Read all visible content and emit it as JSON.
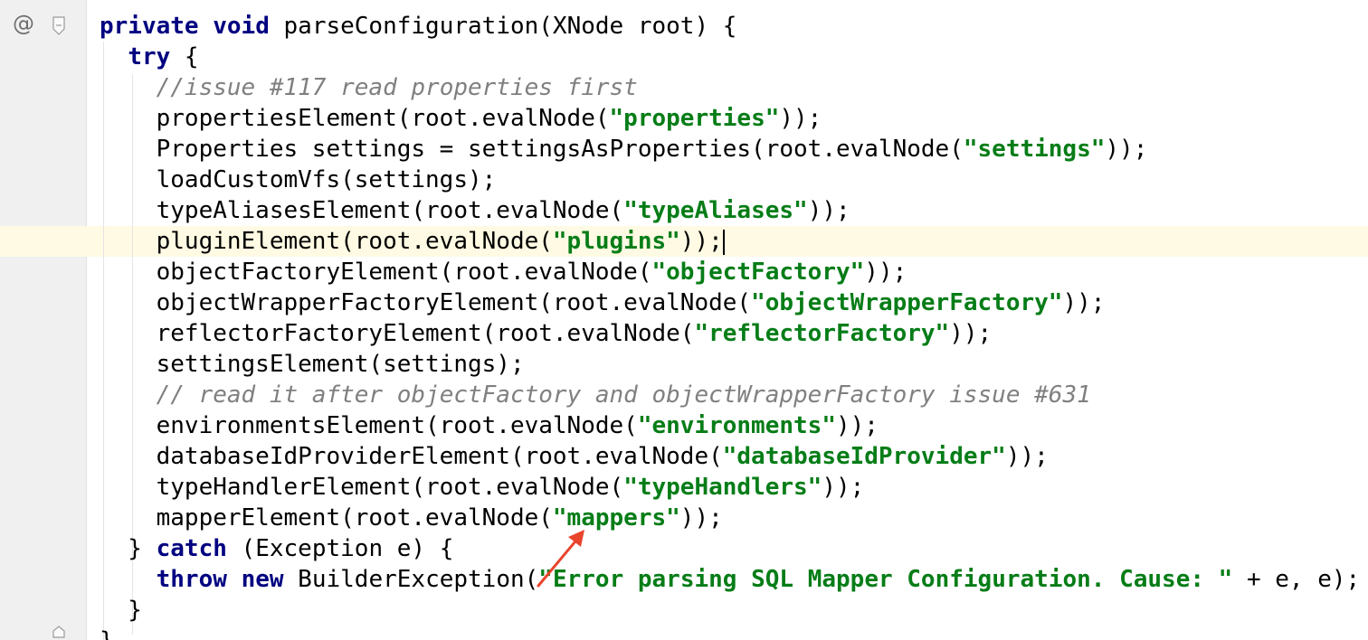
{
  "gutter": {
    "annotation_symbol": "@"
  },
  "code": {
    "lines": [
      [
        {
          "t": "kw",
          "v": "private"
        },
        {
          "t": "p",
          "v": " "
        },
        {
          "t": "kw",
          "v": "void"
        },
        {
          "t": "p",
          "v": " parseConfiguration(XNode root) {"
        }
      ],
      [
        {
          "t": "p",
          "v": "  "
        },
        {
          "t": "kw",
          "v": "try"
        },
        {
          "t": "p",
          "v": " {"
        }
      ],
      [
        {
          "t": "p",
          "v": "    "
        },
        {
          "t": "cmt",
          "v": "//issue #117 read properties first"
        }
      ],
      [
        {
          "t": "p",
          "v": "    propertiesElement(root.evalNode("
        },
        {
          "t": "str",
          "v": "\"properties\""
        },
        {
          "t": "p",
          "v": "));"
        }
      ],
      [
        {
          "t": "p",
          "v": "    Properties settings = settingsAsProperties(root.evalNode("
        },
        {
          "t": "str",
          "v": "\"settings\""
        },
        {
          "t": "p",
          "v": "));"
        }
      ],
      [
        {
          "t": "p",
          "v": "    loadCustomVfs(settings);"
        }
      ],
      [
        {
          "t": "p",
          "v": "    typeAliasesElement(root.evalNode("
        },
        {
          "t": "str",
          "v": "\"typeAliases\""
        },
        {
          "t": "p",
          "v": "));"
        }
      ],
      [
        {
          "t": "p",
          "v": "    pluginElement(root.evalNode("
        },
        {
          "t": "str",
          "v": "\"plugins\""
        },
        {
          "t": "p",
          "v": "));"
        },
        {
          "t": "caret",
          "v": ""
        }
      ],
      [
        {
          "t": "p",
          "v": "    objectFactoryElement(root.evalNode("
        },
        {
          "t": "str",
          "v": "\"objectFactory\""
        },
        {
          "t": "p",
          "v": "));"
        }
      ],
      [
        {
          "t": "p",
          "v": "    objectWrapperFactoryElement(root.evalNode("
        },
        {
          "t": "str",
          "v": "\"objectWrapperFactory\""
        },
        {
          "t": "p",
          "v": "));"
        }
      ],
      [
        {
          "t": "p",
          "v": "    reflectorFactoryElement(root.evalNode("
        },
        {
          "t": "str",
          "v": "\"reflectorFactory\""
        },
        {
          "t": "p",
          "v": "));"
        }
      ],
      [
        {
          "t": "p",
          "v": "    settingsElement(settings);"
        }
      ],
      [
        {
          "t": "p",
          "v": "    "
        },
        {
          "t": "cmt",
          "v": "// read it after objectFactory and objectWrapperFactory issue #631"
        }
      ],
      [
        {
          "t": "p",
          "v": "    environmentsElement(root.evalNode("
        },
        {
          "t": "str",
          "v": "\"environments\""
        },
        {
          "t": "p",
          "v": "));"
        }
      ],
      [
        {
          "t": "p",
          "v": "    databaseIdProviderElement(root.evalNode("
        },
        {
          "t": "str",
          "v": "\"databaseIdProvider\""
        },
        {
          "t": "p",
          "v": "));"
        }
      ],
      [
        {
          "t": "p",
          "v": "    typeHandlerElement(root.evalNode("
        },
        {
          "t": "str",
          "v": "\"typeHandlers\""
        },
        {
          "t": "p",
          "v": "));"
        }
      ],
      [
        {
          "t": "p",
          "v": "    mapperElement(root.evalNode("
        },
        {
          "t": "str",
          "v": "\"mappers\""
        },
        {
          "t": "p",
          "v": "));"
        }
      ],
      [
        {
          "t": "p",
          "v": "  } "
        },
        {
          "t": "kw",
          "v": "catch"
        },
        {
          "t": "p",
          "v": " (Exception e) {"
        }
      ],
      [
        {
          "t": "p",
          "v": "    "
        },
        {
          "t": "kw",
          "v": "throw"
        },
        {
          "t": "p",
          "v": " "
        },
        {
          "t": "kw",
          "v": "new"
        },
        {
          "t": "p",
          "v": " BuilderException("
        },
        {
          "t": "str",
          "v": "\"Error parsing SQL Mapper Configuration. Cause: \""
        },
        {
          "t": "p",
          "v": " + e, e);"
        }
      ],
      [
        {
          "t": "p",
          "v": "  }"
        }
      ],
      [
        {
          "t": "p",
          "v": "}"
        }
      ]
    ]
  },
  "colors": {
    "keyword": "#000080",
    "string": "#067d17",
    "comment": "#808080",
    "caret_line": "#fffae3",
    "annotation_arrow": "#e8452c"
  }
}
